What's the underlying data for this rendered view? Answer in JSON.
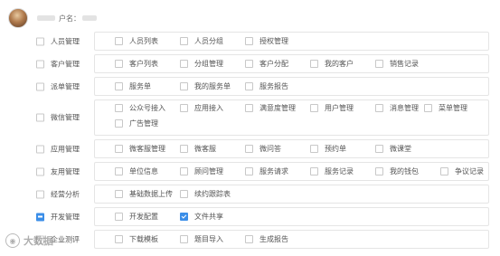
{
  "header": {
    "username_label": "户名："
  },
  "rows": [
    {
      "label": "人员管理",
      "state": "unchecked",
      "items": [
        {
          "label": "人员列表",
          "checked": false
        },
        {
          "label": "人员分组",
          "checked": false
        },
        {
          "label": "授权管理",
          "checked": false
        }
      ]
    },
    {
      "label": "客户管理",
      "state": "unchecked",
      "items": [
        {
          "label": "客户列表",
          "checked": false
        },
        {
          "label": "分组管理",
          "checked": false
        },
        {
          "label": "客户分配",
          "checked": false
        },
        {
          "label": "我的客户",
          "checked": false
        },
        {
          "label": "销售记录",
          "checked": false
        }
      ]
    },
    {
      "label": "派单管理",
      "state": "unchecked",
      "items": [
        {
          "label": "服务单",
          "checked": false
        },
        {
          "label": "我的服务单",
          "checked": false
        },
        {
          "label": "服务报告",
          "checked": false
        }
      ]
    },
    {
      "label": "微信管理",
      "state": "unchecked",
      "items": [
        {
          "label": "公众号接入",
          "checked": false
        },
        {
          "label": "应用接入",
          "checked": false
        },
        {
          "label": "满意度管理",
          "checked": false
        },
        {
          "label": "用户管理",
          "checked": false
        },
        {
          "label": "消息管理",
          "checked": false
        },
        {
          "label": "菜单管理",
          "checked": false
        },
        {
          "label": "广告管理",
          "checked": false
        }
      ]
    },
    {
      "label": "应用管理",
      "state": "unchecked",
      "items": [
        {
          "label": "微客服管理",
          "checked": false
        },
        {
          "label": "微客服",
          "checked": false
        },
        {
          "label": "微问答",
          "checked": false
        },
        {
          "label": "预约单",
          "checked": false
        },
        {
          "label": "微课堂",
          "checked": false
        }
      ]
    },
    {
      "label": "友用管理",
      "state": "unchecked",
      "items": [
        {
          "label": "单位信息",
          "checked": false
        },
        {
          "label": "顾问管理",
          "checked": false
        },
        {
          "label": "服务请求",
          "checked": false
        },
        {
          "label": "服务记录",
          "checked": false
        },
        {
          "label": "我的钱包",
          "checked": false
        },
        {
          "label": "争议记录",
          "checked": false
        }
      ]
    },
    {
      "label": "经营分析",
      "state": "unchecked",
      "items": [
        {
          "label": "基础数据上传",
          "checked": false
        },
        {
          "label": "续约跟踪表",
          "checked": false
        }
      ]
    },
    {
      "label": "开发管理",
      "state": "partial",
      "items": [
        {
          "label": "开发配置",
          "checked": false
        },
        {
          "label": "文件共享",
          "checked": true
        }
      ]
    },
    {
      "label": "企业测评",
      "state": "unchecked",
      "items": [
        {
          "label": "下载模板",
          "checked": false
        },
        {
          "label": "题目导入",
          "checked": false
        },
        {
          "label": "生成报告",
          "checked": false
        }
      ]
    }
  ],
  "watermark": {
    "text": "大数据",
    "icon": "weibo-icon"
  },
  "colors": {
    "accent": "#3b8ee8",
    "border": "#e5e5e5",
    "text": "#555555"
  }
}
